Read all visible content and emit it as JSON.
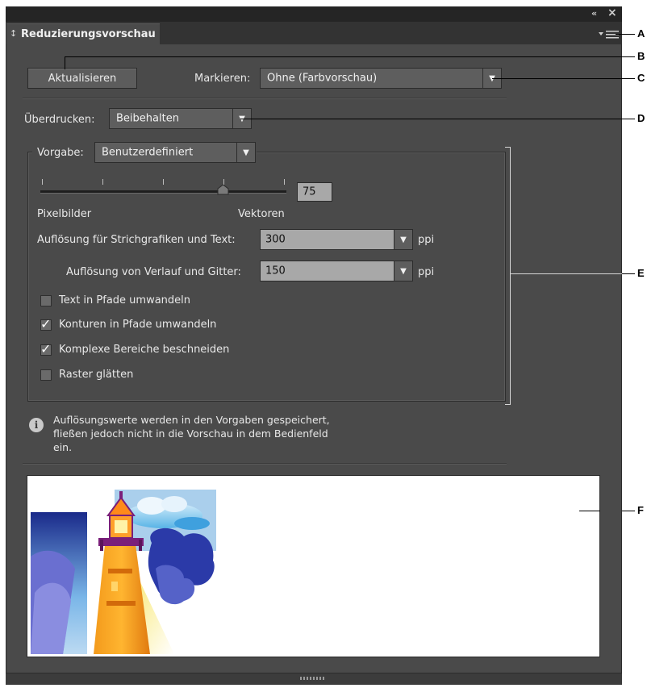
{
  "window": {
    "collapse_icon": "double-chevron-left-icon",
    "close_icon": "close-icon",
    "collapse_glyph": "«",
    "close_glyph": "×"
  },
  "tab": {
    "icon": "updown-chevron-icon",
    "glyph": "↕",
    "title": "Reduzierungsvorschau"
  },
  "toolbar": {
    "refresh_label": "Aktualisieren",
    "highlight_label": "Markieren:",
    "highlight_value": "Ohne (Farbvorschau)"
  },
  "overprint": {
    "label": "Überdrucken:",
    "value": "Beibehalten"
  },
  "preset": {
    "label": "Vorgabe:",
    "value": "Benutzerdefiniert",
    "slider": {
      "value": "75",
      "left_label": "Pixelbilder",
      "right_label": "Vektoren"
    },
    "line_art_label": "Auflösung für Strichgrafiken und Text:",
    "line_art_value": "300",
    "line_art_unit": "ppi",
    "gradient_label": "Auflösung von Verlauf und Gitter:",
    "gradient_value": "150",
    "gradient_unit": "ppi",
    "checkboxes": [
      {
        "label": "Text in Pfade umwandeln",
        "checked": false
      },
      {
        "label": "Konturen in Pfade umwandeln",
        "checked": true
      },
      {
        "label": "Komplexe Bereiche beschneiden",
        "checked": true
      },
      {
        "label": "Raster glätten",
        "checked": false
      }
    ]
  },
  "info": {
    "icon": "info-icon",
    "glyph": "i",
    "line1": "Auflösungswerte werden in den Vorgaben gespeichert,",
    "line2": "fließen jedoch nicht in die Vorschau in dem Bedienfeld",
    "line3": "ein."
  },
  "callouts": [
    "A",
    "B",
    "C",
    "D",
    "E",
    "F"
  ],
  "colors": {
    "panel_bg": "#4a4a4a",
    "dropdown_bg": "#5e5e5e",
    "field_bg": "#a8a8a8",
    "callout_line": "#000000"
  }
}
